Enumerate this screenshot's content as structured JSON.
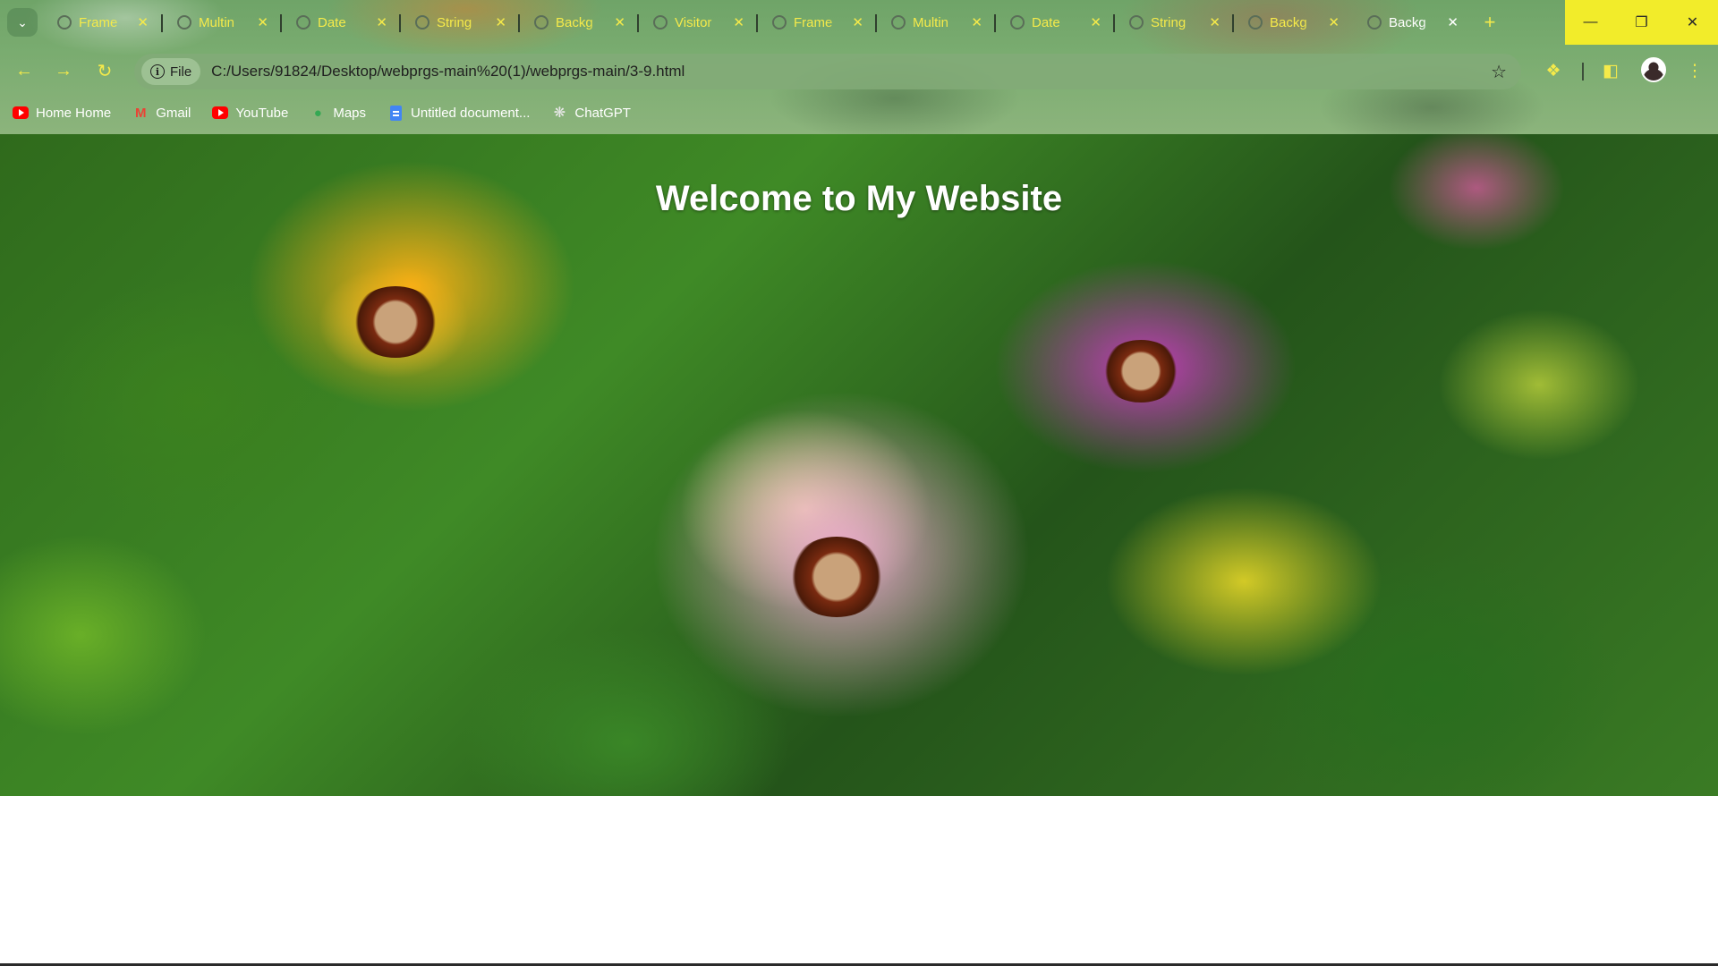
{
  "browser": {
    "tabs": [
      {
        "title": "Frame"
      },
      {
        "title": "Multin"
      },
      {
        "title": "Date"
      },
      {
        "title": "String"
      },
      {
        "title": "Backg"
      },
      {
        "title": "Visitor"
      },
      {
        "title": "Frame"
      },
      {
        "title": "Multin"
      },
      {
        "title": "Date"
      },
      {
        "title": "String"
      },
      {
        "title": "Backg"
      },
      {
        "title": "Backg",
        "active": true
      }
    ],
    "tab_close_glyph": "✕",
    "new_tab_glyph": "+",
    "site_chip_label": "File",
    "url": "C:/Users/91824/Desktop/webprgs-main%20(1)/webprgs-main/3-9.html",
    "bookmarks": [
      {
        "label": "Home Home",
        "icon": "youtube-icon"
      },
      {
        "label": "Gmail",
        "icon": "gmail-icon"
      },
      {
        "label": "YouTube",
        "icon": "youtube-icon"
      },
      {
        "label": "Maps",
        "icon": "maps-icon"
      },
      {
        "label": "Untitled document...",
        "icon": "docs-icon"
      },
      {
        "label": "ChatGPT",
        "icon": "chatgpt-icon"
      }
    ],
    "accent_color": "#f5ea4a",
    "window_controls_color": "#f2ec2a"
  },
  "page": {
    "heading": "Welcome to My Website"
  }
}
